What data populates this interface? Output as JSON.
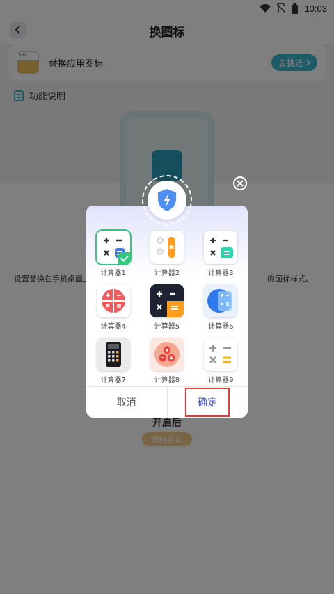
{
  "status_bar": {
    "time": "10:03"
  },
  "header": {
    "title": "换图标"
  },
  "replace_card": {
    "thumb_text": "123",
    "label": "替换应用图标",
    "button_label": "去挑选"
  },
  "function_section": {
    "label": "功能说明"
  },
  "description": {
    "left_text": "设置替换在手机桌面上",
    "right_text": "的图标样式。"
  },
  "password_section": {
    "title": "开启后",
    "badge": "密码验证"
  },
  "dialog": {
    "icons": [
      {
        "label": "计算器1",
        "selected": true
      },
      {
        "label": "计算器2",
        "selected": false
      },
      {
        "label": "计算器3",
        "selected": false
      },
      {
        "label": "计算器4",
        "selected": false
      },
      {
        "label": "计算器5",
        "selected": false
      },
      {
        "label": "计算器6",
        "selected": false
      },
      {
        "label": "计算器7",
        "selected": false
      },
      {
        "label": "计算器8",
        "selected": false
      },
      {
        "label": "计算器9",
        "selected": false
      }
    ],
    "cancel_label": "取消",
    "confirm_label": "确定"
  },
  "colors": {
    "accent": "#39b6cf",
    "confirm": "#3a4cc9",
    "highlight": "#e33b3b",
    "selected": "#35c77e"
  }
}
